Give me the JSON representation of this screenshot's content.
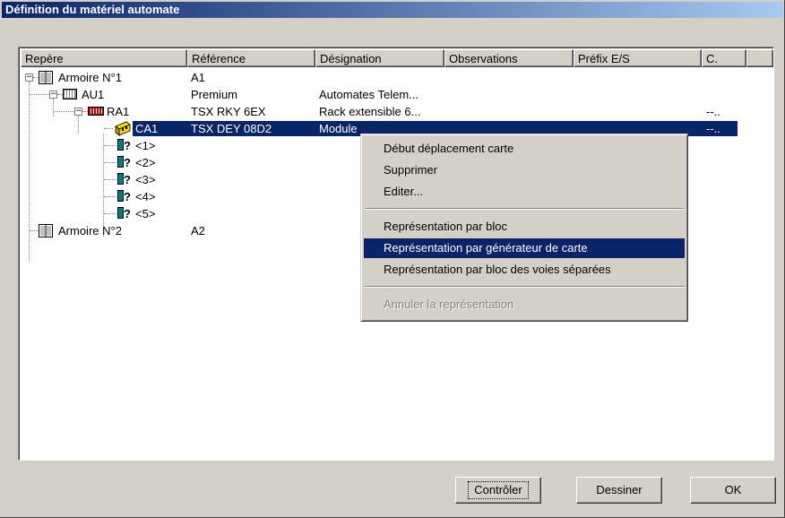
{
  "window": {
    "title": "Définition du matériel automate"
  },
  "columns": [
    "Repère",
    "Référence",
    "Désignation",
    "Observations",
    "Préfix E/S",
    "C."
  ],
  "tree": [
    {
      "repere": "Armoire N°1",
      "reference": "A1",
      "designation": "",
      "c": "",
      "icon": "cabinet-icon"
    },
    {
      "repere": "AU1",
      "reference": "Premium",
      "designation": "Automates Telem...",
      "c": "",
      "icon": "plc-icon"
    },
    {
      "repere": "RA1",
      "reference": "TSX RKY 6EX",
      "designation": "Rack extensible 6...",
      "c": "--..",
      "icon": "rack-icon"
    },
    {
      "repere": "CA1",
      "reference": "TSX DEY 08D2",
      "designation": "Module",
      "c": "--..",
      "icon": "card-icon",
      "selected": true
    },
    {
      "repere": "<1>",
      "reference": "",
      "designation": "",
      "c": "",
      "icon": "unknown-slot-icon"
    },
    {
      "repere": "<2>",
      "reference": "",
      "designation": "",
      "c": "",
      "icon": "unknown-slot-icon"
    },
    {
      "repere": "<3>",
      "reference": "",
      "designation": "",
      "c": "",
      "icon": "unknown-slot-icon"
    },
    {
      "repere": "<4>",
      "reference": "",
      "designation": "",
      "c": "",
      "icon": "unknown-slot-icon"
    },
    {
      "repere": "<5>",
      "reference": "",
      "designation": "",
      "c": "",
      "icon": "unknown-slot-icon"
    },
    {
      "repere": "Armoire N°2",
      "reference": "A2",
      "designation": "",
      "c": "",
      "icon": "cabinet-icon"
    }
  ],
  "context_menu": {
    "items": [
      {
        "label": "Début déplacement carte",
        "state": "normal"
      },
      {
        "label": "Supprimer",
        "state": "normal"
      },
      {
        "label": "Editer...",
        "state": "normal"
      },
      {
        "label": "Représentation par bloc",
        "state": "normal"
      },
      {
        "label": "Représentation par générateur de carte",
        "state": "highlighted"
      },
      {
        "label": "Représentation par bloc des voies séparées",
        "state": "normal"
      },
      {
        "label": "Annuler la représentation",
        "state": "disabled"
      }
    ]
  },
  "buttons": {
    "controler": "Contrôler",
    "dessiner": "Dessiner",
    "ok": "OK"
  },
  "colors": {
    "title_start": "#0a246a",
    "title_end": "#a6caf0",
    "selection": "#0a246a",
    "face": "#d4d0c8"
  }
}
